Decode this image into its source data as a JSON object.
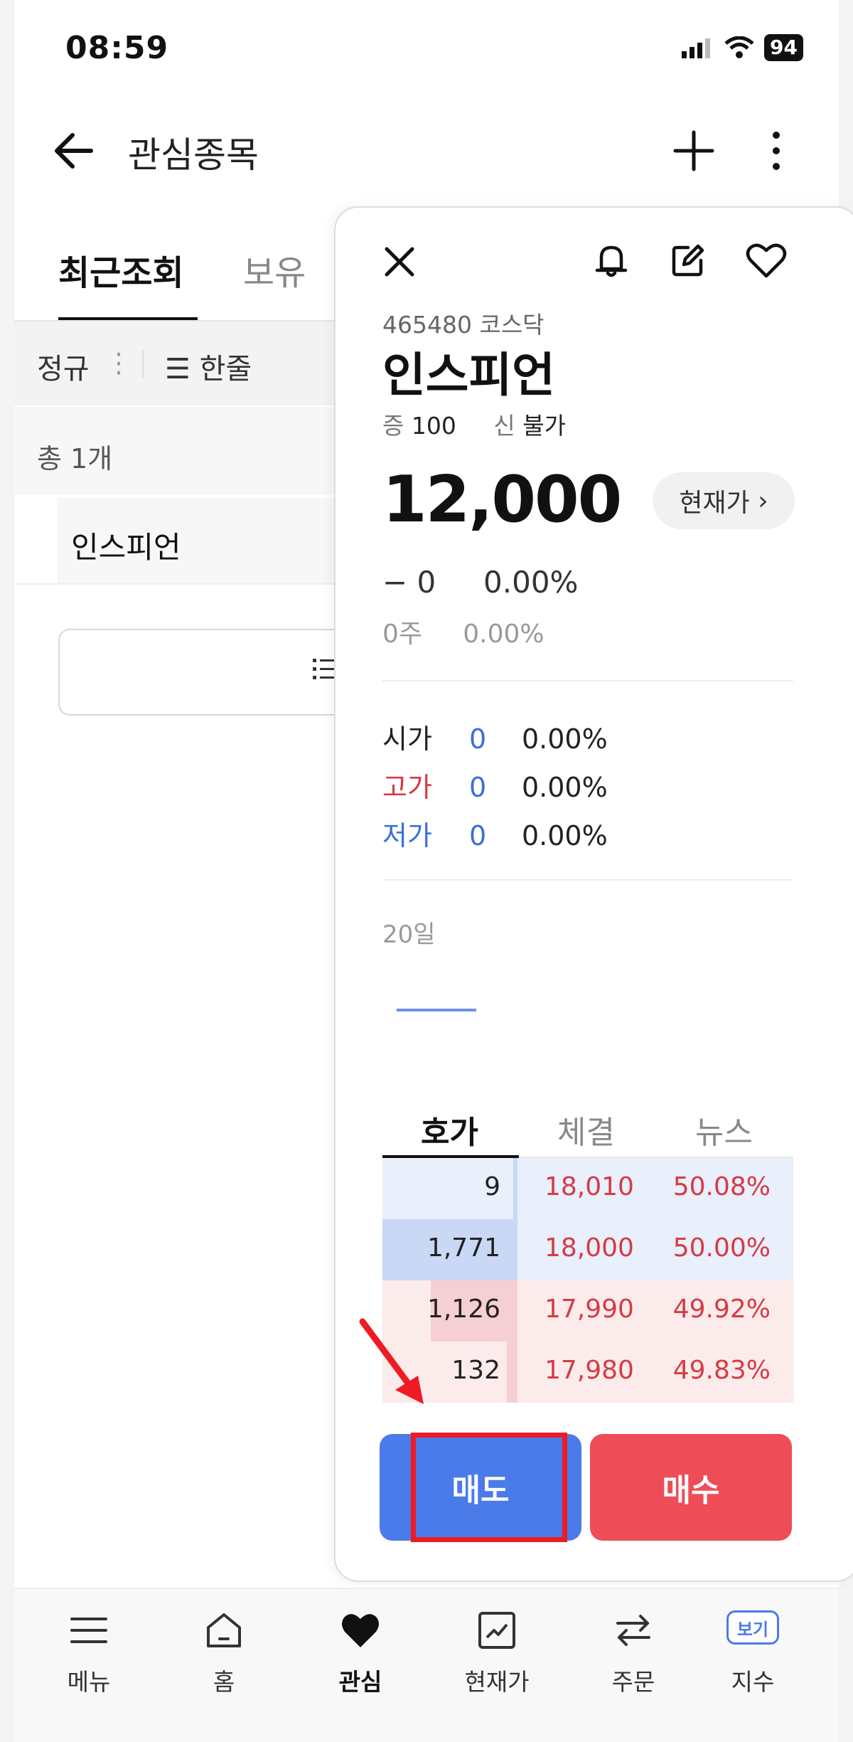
{
  "status_bar": {
    "time": "08:59",
    "battery": "94"
  },
  "header": {
    "title": "관심종목"
  },
  "left_list": {
    "tabs": [
      "최근조회",
      "보유"
    ],
    "filter_regular": "정규",
    "filter_oneline": "한줄",
    "total": "총 1개",
    "items": [
      {
        "name": "인스피언"
      }
    ]
  },
  "panel": {
    "code_market": "465480 코스닥",
    "name": "인스피언",
    "margin": {
      "jeung_label": "증",
      "jeung_value": "100",
      "sin_label": "신",
      "sin_value": "불가"
    },
    "price": "12,000",
    "current_price_button": "현재가",
    "change": "− 0",
    "change_pct": "0.00%",
    "volume": "0주",
    "volume_pct": "0.00%",
    "ohl": [
      {
        "label": "시가",
        "value": "0",
        "pct": "0.00%",
        "color": "#222222"
      },
      {
        "label": "고가",
        "value": "0",
        "pct": "0.00%",
        "color": "#d63a44"
      },
      {
        "label": "저가",
        "value": "0",
        "pct": "0.00%",
        "color": "#3b6fd8"
      }
    ],
    "period": "20일",
    "orderbook_tabs": [
      "호가",
      "체결",
      "뉴스"
    ],
    "orderbook": [
      {
        "qty": "9",
        "price": "18,010",
        "pct": "50.08%",
        "side": "ask",
        "qty_ratio": 0.005
      },
      {
        "qty": "1,771",
        "price": "18,000",
        "pct": "50.00%",
        "side": "ask",
        "qty_ratio": 1.0
      },
      {
        "qty": "1,126",
        "price": "17,990",
        "pct": "49.92%",
        "side": "bid",
        "qty_ratio": 0.64
      },
      {
        "qty": "132",
        "price": "17,980",
        "pct": "49.83%",
        "side": "bid",
        "qty_ratio": 0.08
      }
    ],
    "sell_label": "매도",
    "buy_label": "매수"
  },
  "bottom_nav": [
    {
      "label": "메뉴",
      "icon": "menu-icon"
    },
    {
      "label": "홈",
      "icon": "home-icon"
    },
    {
      "label": "관심",
      "icon": "heart-icon",
      "active": true
    },
    {
      "label": "현재가",
      "icon": "chart-icon"
    },
    {
      "label": "주문",
      "icon": "swap-icon"
    },
    {
      "label": "지수",
      "icon": "view-badge",
      "badge": "보기"
    }
  ],
  "colors": {
    "accent_blue": "#4a7be8",
    "accent_red": "#ee4d58",
    "highlight": "#ee1b24"
  }
}
